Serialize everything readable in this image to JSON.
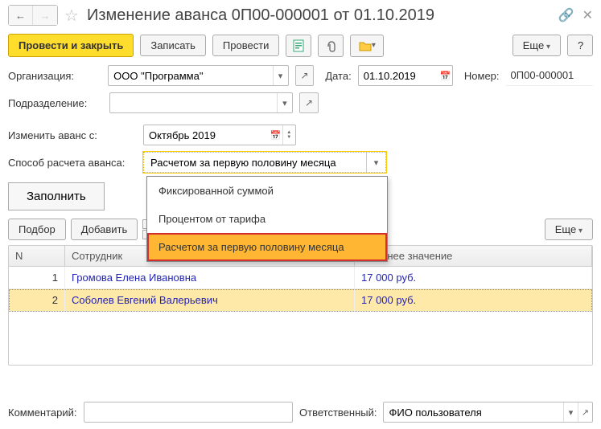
{
  "header": {
    "title": "Изменение аванса 0П00-000001 от 01.10.2019"
  },
  "toolbar": {
    "post_close": "Провести и закрыть",
    "save": "Записать",
    "post": "Провести",
    "more": "Еще",
    "help": "?"
  },
  "form": {
    "org_label": "Организация:",
    "org_value": "ООО \"Программа\"",
    "date_label": "Дата:",
    "date_value": "01.10.2019",
    "number_label": "Номер:",
    "number_value": "0П00-000001",
    "dept_label": "Подразделение:",
    "dept_value": "",
    "change_from_label": "Изменить аванс с:",
    "change_from_value": "Октябрь 2019",
    "method_label": "Способ расчета аванса:",
    "method_value": "Расчетом за первую половину месяца",
    "fill": "Заполнить"
  },
  "dropdown": {
    "options": [
      "Фиксированной суммой",
      "Процентом от тарифа",
      "Расчетом за первую половину месяца"
    ]
  },
  "table_toolbar": {
    "pick": "Подбор",
    "add": "Добавить",
    "more": "Еще"
  },
  "grid": {
    "col_n": "N",
    "col_emp": "Сотрудник",
    "col_prev": "Прежнее значение",
    "rows": [
      {
        "n": "1",
        "emp": "Громова Елена Ивановна",
        "prev": "17 000 руб."
      },
      {
        "n": "2",
        "emp": "Соболев Евгений Валерьевич",
        "prev": "17 000 руб."
      }
    ]
  },
  "footer": {
    "comment_label": "Комментарий:",
    "comment_value": "",
    "resp_label": "Ответственный:",
    "resp_value": "ФИО пользователя"
  }
}
